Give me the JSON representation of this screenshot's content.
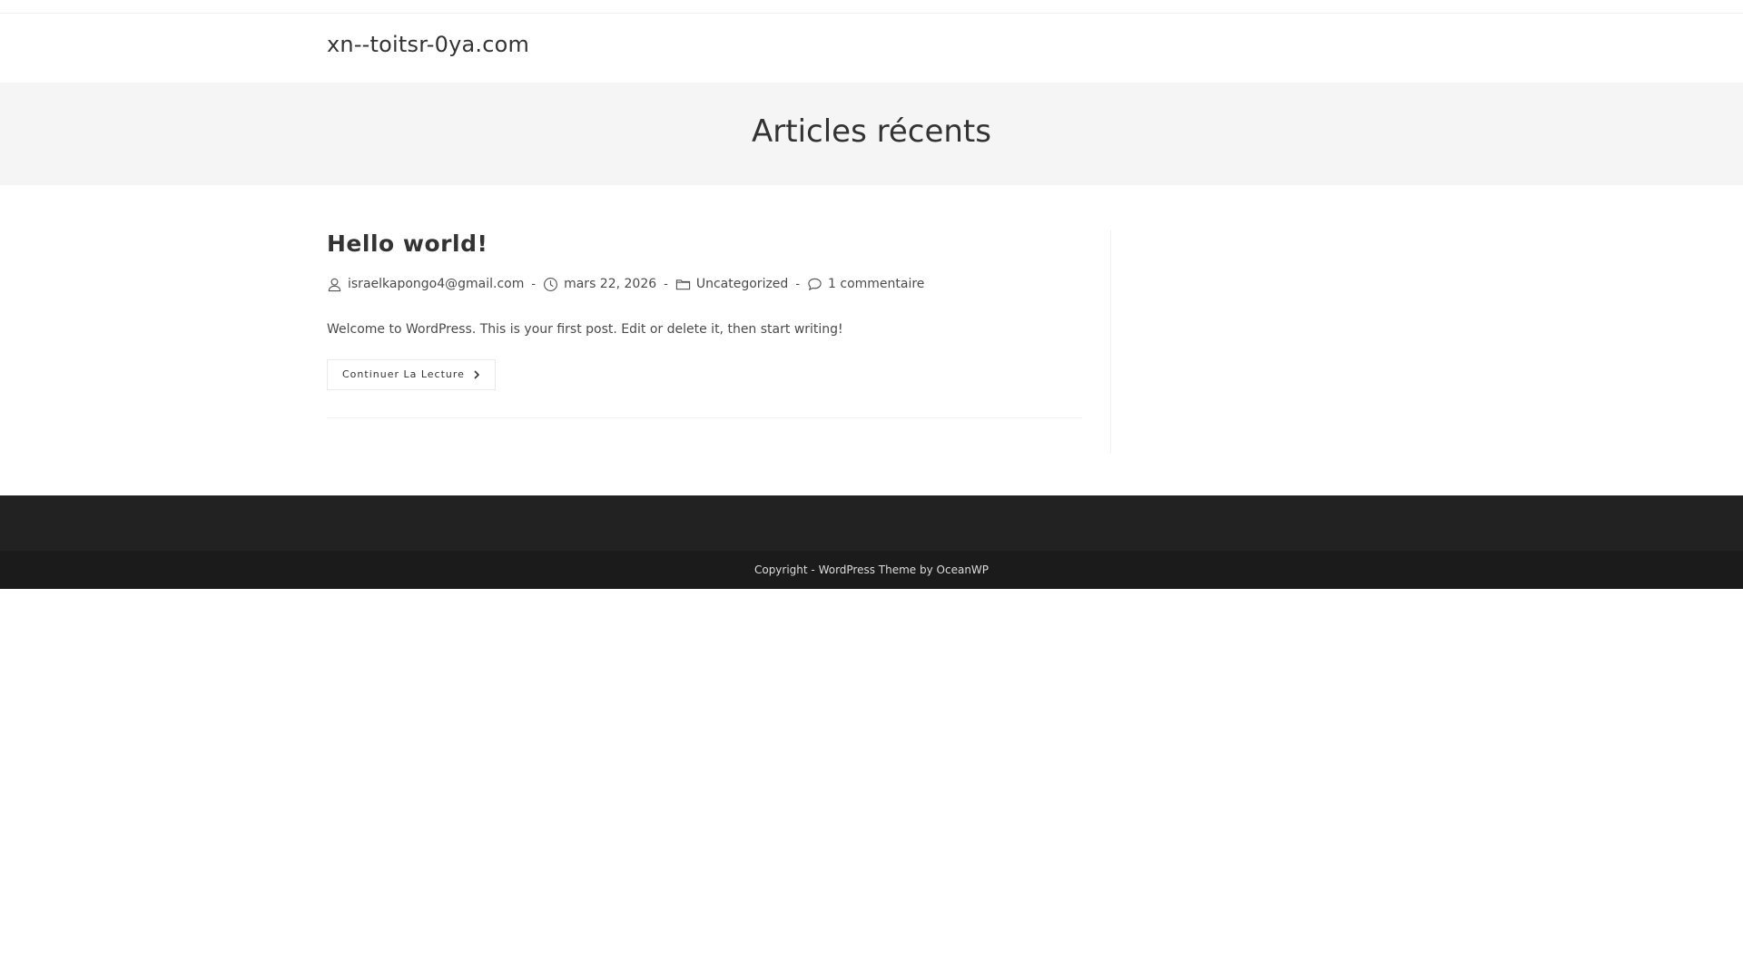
{
  "site": {
    "title": "xn--toitsr-0ya.com"
  },
  "page_header": {
    "title": "Articles récents"
  },
  "post": {
    "title": "Hello world!",
    "author": "israelkapongo4@gmail.com",
    "date": "mars 22, 2026",
    "category": "Uncategorized",
    "comments": "1 commentaire",
    "meta_separator": "-",
    "excerpt": "Welcome to WordPress. This is your first post. Edit or delete it, then start writing!",
    "read_more_label": "Continuer La Lecture"
  },
  "footer": {
    "copyright": "Copyright - WordPress Theme by OceanWP"
  },
  "icons": {
    "author": "user-icon",
    "date": "clock-icon",
    "category": "folder-icon",
    "comments": "comment-icon",
    "read_more": "chevron-right-icon"
  },
  "colors": {
    "page_header_bg": "#f5f5f5",
    "footer_widgets_bg": "#222222",
    "footer_bottom_bg": "#1b1b1b",
    "text": "#333333"
  }
}
